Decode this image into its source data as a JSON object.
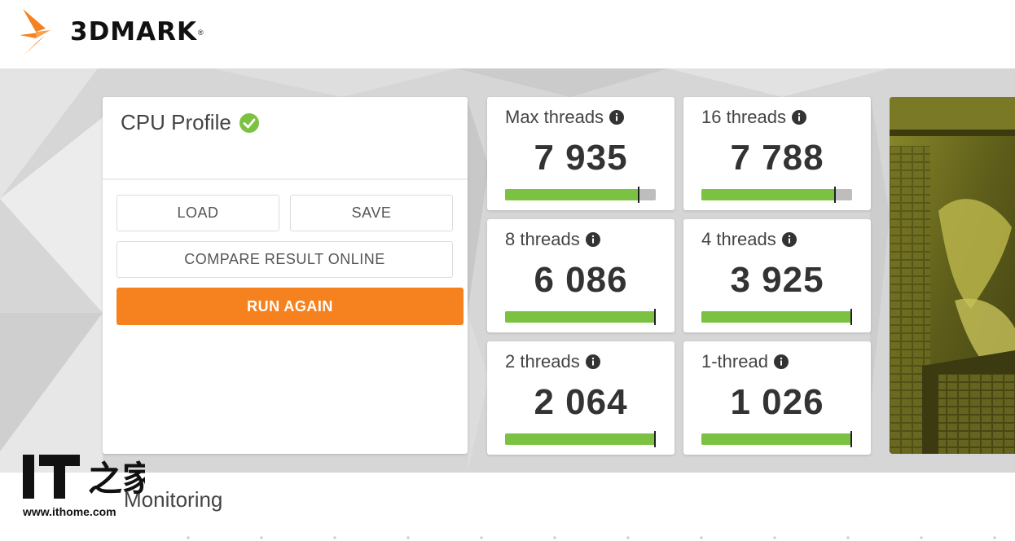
{
  "brand": {
    "name": "3DMARK",
    "registered": "®",
    "accent": "#f5821f"
  },
  "result": {
    "title": "CPU Profile",
    "status_icon": "check-circle-icon",
    "status_color": "#7cc242",
    "buttons": {
      "load": "LOAD",
      "save": "SAVE",
      "compare": "COMPARE RESULT ONLINE",
      "run_again": "RUN AGAIN"
    }
  },
  "scores": [
    {
      "label": "Max threads",
      "score": "7 935",
      "progress": 0.89
    },
    {
      "label": "16 threads",
      "score": "7 788",
      "progress": 0.89
    },
    {
      "label": "8 threads",
      "score": "6 086",
      "progress": 1.0
    },
    {
      "label": "4 threads",
      "score": "3 925",
      "progress": 1.0
    },
    {
      "label": "2 threads",
      "score": "2 064",
      "progress": 1.0
    },
    {
      "label": "1-thread",
      "score": "1 026",
      "progress": 1.0
    }
  ],
  "colors": {
    "bar_fill": "#7cc242",
    "bar_track": "#bdbdbd",
    "background": "#d6d6d6"
  },
  "monitoring": {
    "title": "Monitoring"
  },
  "watermark": {
    "logo_text": "IT之家",
    "url": "www.ithome.com"
  }
}
